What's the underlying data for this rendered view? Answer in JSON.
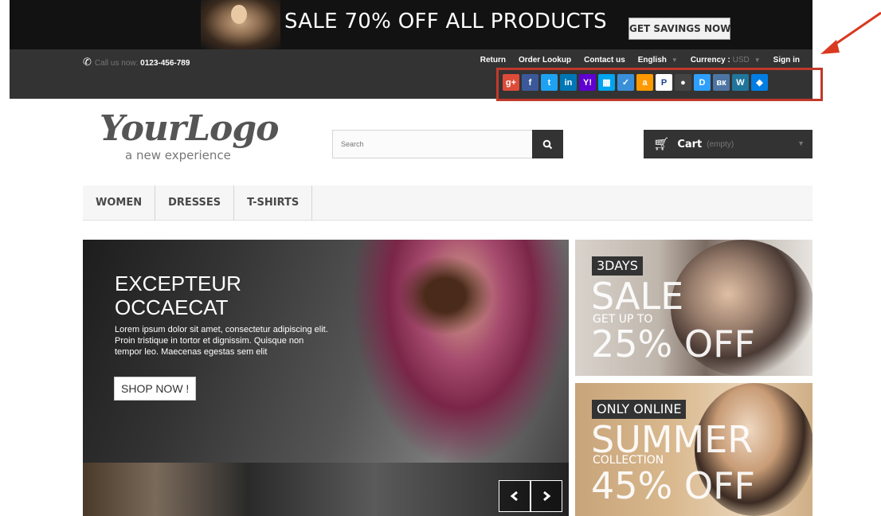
{
  "banner": {
    "text": "SALE 70% OFF ALL PRODUCTS",
    "button": "GET SAVINGS NOW"
  },
  "topbar": {
    "call_label": "Call us now:",
    "phone": "0123-456-789",
    "links": [
      "Return",
      "Order Lookup",
      "Contact us"
    ],
    "language": "English",
    "currency_label": "Currency :",
    "currency_value": "USD",
    "signin": "Sign in"
  },
  "social_icons": [
    {
      "name": "google-plus-icon",
      "glyph": "g+",
      "color": "#dd4b39"
    },
    {
      "name": "facebook-icon",
      "glyph": "f",
      "color": "#3b5998"
    },
    {
      "name": "twitter-icon",
      "glyph": "t",
      "color": "#1da1f2"
    },
    {
      "name": "linkedin-icon",
      "glyph": "in",
      "color": "#0077b5"
    },
    {
      "name": "yahoo-icon",
      "glyph": "Y!",
      "color": "#5f01d1"
    },
    {
      "name": "windows-live-icon",
      "glyph": "▦",
      "color": "#00a4ef"
    },
    {
      "name": "check-icon",
      "glyph": "✓",
      "color": "#3a8fd9"
    },
    {
      "name": "amazon-icon",
      "glyph": "a",
      "color": "#ff9900"
    },
    {
      "name": "paypal-icon",
      "glyph": "P",
      "color": "#ffffff"
    },
    {
      "name": "github-icon",
      "glyph": "●",
      "color": "#444444"
    },
    {
      "name": "disqus-icon",
      "glyph": "D",
      "color": "#2e9fff"
    },
    {
      "name": "vk-icon",
      "glyph": "вк",
      "color": "#4c75a3"
    },
    {
      "name": "wordpress-icon",
      "glyph": "W",
      "color": "#21759b"
    },
    {
      "name": "dropbox-icon",
      "glyph": "◆",
      "color": "#007ee5"
    }
  ],
  "header": {
    "logo_main": "YourLogo",
    "logo_sub": "a new experience",
    "search_placeholder": "Search",
    "cart_label": "Cart",
    "cart_state": "(empty)"
  },
  "menu": [
    "WOMEN",
    "DRESSES",
    "T-SHIRTS"
  ],
  "hero": {
    "title_line1": "EXCEPTEUR",
    "title_line2": "OCCAECAT",
    "text": "Lorem ipsum dolor sit amet, consectetur adipiscing elit. Proin tristique in tortor et dignissim. Quisque non tempor leo. Maecenas egestas sem elit",
    "button": "SHOP NOW !"
  },
  "side_banners": [
    {
      "tag": "3DAYS",
      "big": "SALE",
      "small": "GET UP TO",
      "big2": "25% OFF"
    },
    {
      "tag": "ONLY ONLINE",
      "big": "SUMMER",
      "small": "COLLECTION",
      "big2": "45% OFF"
    }
  ],
  "colors": {
    "annotation": "#c0392b",
    "dark_bar": "#333333"
  }
}
